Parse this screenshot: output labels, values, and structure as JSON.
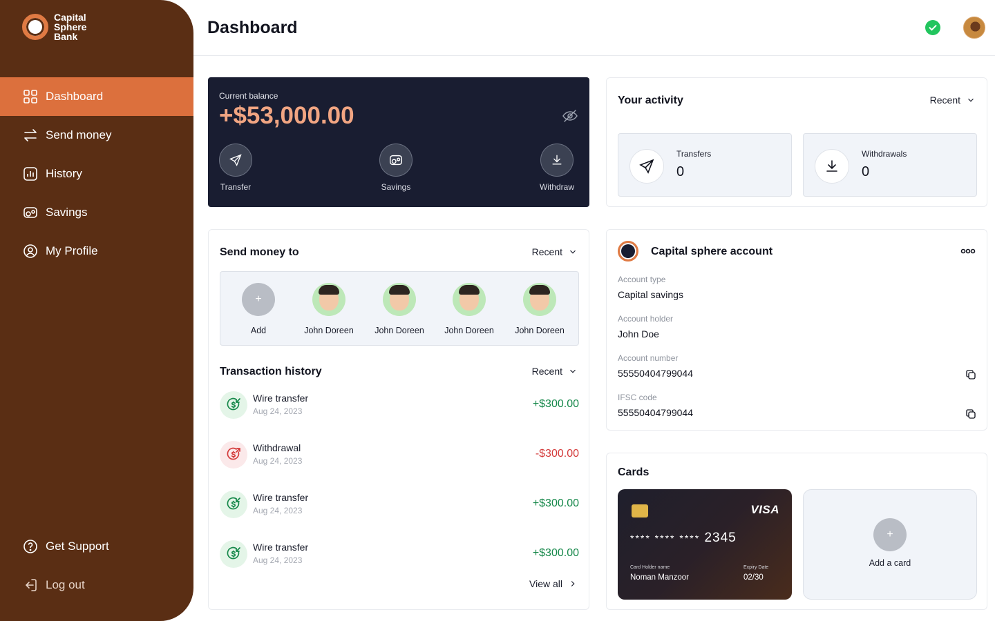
{
  "brand": {
    "line1": "Capital",
    "line2": "Sphere",
    "line3": "Bank"
  },
  "colors": {
    "sidebar": "#5a2e14",
    "accent": "#dc703d",
    "balance_bg": "#191d31",
    "positive": "#16884a",
    "negative": "#d43b3b"
  },
  "nav": {
    "items": [
      {
        "label": "Dashboard",
        "icon": "grid-icon"
      },
      {
        "label": "Send money",
        "icon": "swap-arrows-icon"
      },
      {
        "label": "History",
        "icon": "bar-chart-icon"
      },
      {
        "label": "Savings",
        "icon": "piggy-bank-icon"
      },
      {
        "label": "My Profile",
        "icon": "user-circle-icon"
      }
    ],
    "bottom": [
      {
        "label": "Get Support",
        "icon": "help-circle-icon"
      },
      {
        "label": "Log out",
        "icon": "logout-icon"
      }
    ]
  },
  "header": {
    "title": "Dashboard"
  },
  "balance": {
    "label": "Current balance",
    "amount": "+$53,000.00",
    "actions": [
      {
        "label": "Transfer",
        "icon": "send-icon"
      },
      {
        "label": "Savings",
        "icon": "piggy-bank-icon"
      },
      {
        "label": "Withdraw",
        "icon": "download-icon"
      }
    ]
  },
  "activity": {
    "title": "Your activity",
    "filter": "Recent",
    "stats": [
      {
        "label": "Transfers",
        "value": "0"
      },
      {
        "label": "Withdrawals",
        "value": "0"
      }
    ]
  },
  "send_money": {
    "title": "Send money to",
    "filter": "Recent",
    "add_label": "Add",
    "add_symbol": "+",
    "contacts": [
      "John Doreen",
      "John Doreen",
      "John Doreen",
      "John Doreen"
    ]
  },
  "transactions": {
    "title": "Transaction history",
    "filter": "Recent",
    "items": [
      {
        "name": "Wire transfer",
        "date": "Aug 24, 2023",
        "amount": "+$300.00",
        "type": "in"
      },
      {
        "name": "Withdrawal",
        "date": "Aug 24, 2023",
        "amount": "-$300.00",
        "type": "out"
      },
      {
        "name": "Wire transfer",
        "date": "Aug 24, 2023",
        "amount": "+$300.00",
        "type": "in"
      },
      {
        "name": "Wire transfer",
        "date": "Aug 24, 2023",
        "amount": "+$300.00",
        "type": "in"
      }
    ],
    "view_all": "View all"
  },
  "account": {
    "title": "Capital sphere account",
    "fields": [
      {
        "label": "Account type",
        "value": "Capital savings",
        "copy": false
      },
      {
        "label": "Account holder",
        "value": "John Doe",
        "copy": false
      },
      {
        "label": "Account number",
        "value": "55550404799044",
        "copy": true
      },
      {
        "label": "IFSC code",
        "value": "55550404799044",
        "copy": true
      }
    ]
  },
  "cards": {
    "title": "Cards",
    "card": {
      "brand": "VISA",
      "masked": "**** **** ****",
      "last4": "2345",
      "holder_label": "Card Holder name",
      "holder": "Noman Manzoor",
      "expiry_label": "Expiry Date",
      "expiry": "02/30"
    },
    "add_label": "Add a card",
    "add_symbol": "+"
  }
}
